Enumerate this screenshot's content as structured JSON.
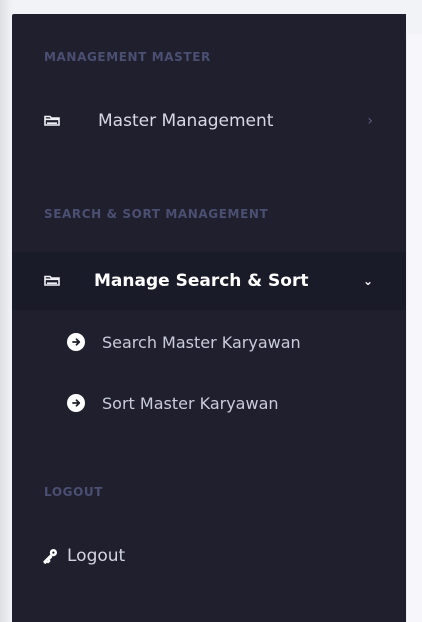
{
  "sidebar": {
    "sections": {
      "management_master": "MANAGEMENT MASTER",
      "search_sort_management": "SEARCH & SORT MANAGEMENT",
      "logout": "LOGOUT"
    },
    "items": [
      {
        "label": "Master Management",
        "icon": "folder-icon",
        "chevron": "›"
      },
      {
        "label": "Manage Search & Sort",
        "icon": "folder-icon",
        "chevron": "⌄"
      }
    ],
    "subitems": [
      {
        "label": "Search Master Karyawan",
        "icon": "arrow-circle-right-icon"
      },
      {
        "label": "Sort Master Karyawan",
        "icon": "arrow-circle-right-icon"
      }
    ],
    "logout": {
      "label": "Logout",
      "icon": "key-icon"
    }
  },
  "colors": {
    "sidebar_bg": "#1f1f2d",
    "active_bg": "#1a1b28",
    "section_text": "#4b4f72",
    "primary_text": "#d7d9e6",
    "white_text": "#ffffff"
  }
}
